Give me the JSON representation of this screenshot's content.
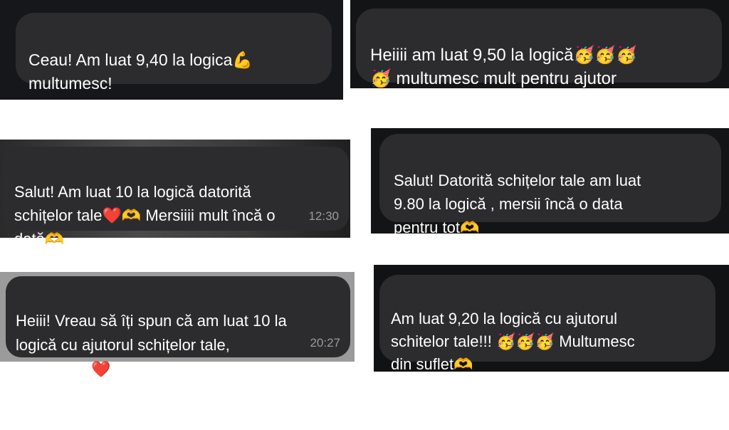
{
  "screenshots": [
    {
      "text": "Ceau! Am luat 9,40 la logica💪\nmultumesc!",
      "time": ""
    },
    {
      "text": "Heiiii am luat 9,50 la logică🥳🥳🥳\n🥳 multumesc mult pentru ajutor",
      "time": ""
    },
    {
      "text": "Salut! Am luat 10 la logică datorită\nschițelor tale❤️🫶 Mersiiii mult încă o\ndată🫶",
      "time": "12:30"
    },
    {
      "text": "Salut! Datorită schițelor tale am luat\n9.80 la logică , mersii încă o data\npentru tot🫶",
      "time": ""
    },
    {
      "text": "Heiii! Vreau să îți spun că am luat 10 la\nlogică cu ajutorul schițelor tale,\nmulțumesc❤️",
      "time": "20:27"
    },
    {
      "text": "Am luat 9,20 la logică cu ajutorul\nschitelor tale!!! 🥳🥳🥳 Multumesc\ndin suflet🫶",
      "time": ""
    }
  ]
}
